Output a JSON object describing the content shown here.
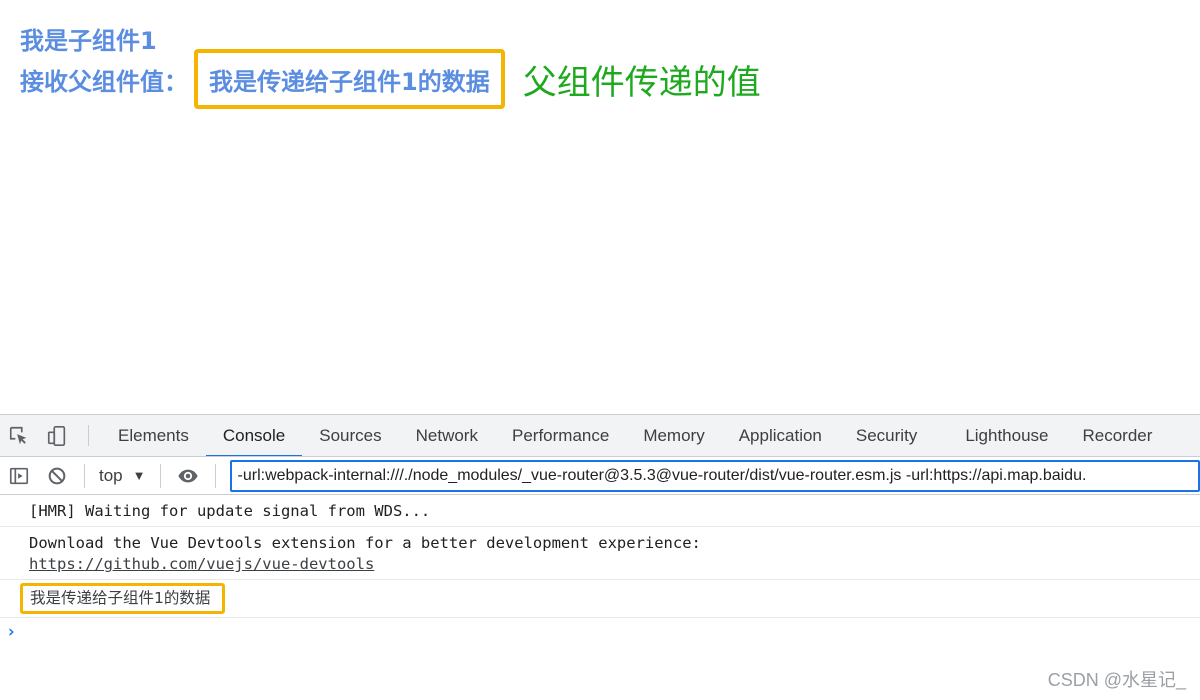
{
  "page": {
    "child_title": "我是子组件1",
    "receive_label": "接收父组件值：",
    "received_value": "我是传递给子组件1的数据",
    "parent_annotation": "父组件传递的值"
  },
  "devtools": {
    "tabs": [
      {
        "label": "Elements"
      },
      {
        "label": "Console"
      },
      {
        "label": "Sources"
      },
      {
        "label": "Network"
      },
      {
        "label": "Performance"
      },
      {
        "label": "Memory"
      },
      {
        "label": "Application"
      },
      {
        "label": "Security"
      },
      {
        "label": "Lighthouse"
      },
      {
        "label": "Recorder"
      }
    ],
    "active_tab": "Console",
    "context": "top",
    "filter_value": "-url:webpack-internal:///./node_modules/_vue-router@3.5.3@vue-router/dist/vue-router.esm.js -url:https://api.map.baidu.",
    "messages": {
      "hmr": "[HMR] Waiting for update signal from WDS...",
      "devtools_hint": "Download the Vue Devtools extension for a better development experience:",
      "devtools_link": "https://github.com/vuejs/vue-devtools",
      "logged_value": "我是传递给子组件1的数据"
    },
    "prompt": "›"
  },
  "watermark": "CSDN @水星记_",
  "colors": {
    "child_text": "#5b8de0",
    "highlight_border": "#f5b400",
    "annotation_green": "#1fa91f",
    "devtools_accent": "#1a73e8"
  }
}
